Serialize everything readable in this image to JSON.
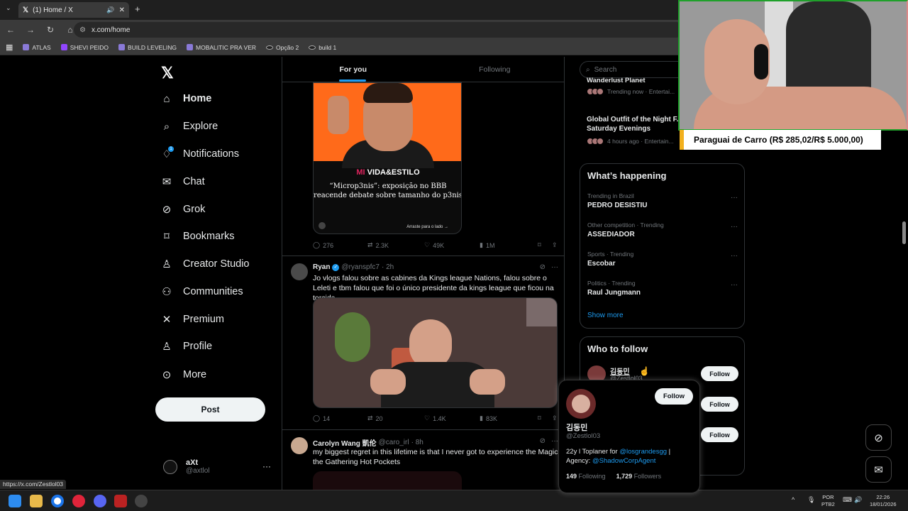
{
  "browser": {
    "tab_title": "(1) Home / X",
    "url": "x.com/home",
    "bookmarks": [
      "ATLAS",
      "SHEVI PEIDO",
      "BUILD LEVELING",
      "MOBALITIC PRA VER",
      "Opção 2",
      "build 1"
    ],
    "status_url": "https://x.com/Zestlol03"
  },
  "nav": {
    "items": [
      {
        "label": "Home",
        "icon": "home-icon"
      },
      {
        "label": "Explore",
        "icon": "search-icon"
      },
      {
        "label": "Notifications",
        "icon": "bell-icon",
        "badge": "1"
      },
      {
        "label": "Chat",
        "icon": "mail-icon"
      },
      {
        "label": "Grok",
        "icon": "grok-icon"
      },
      {
        "label": "Bookmarks",
        "icon": "bookmark-icon"
      },
      {
        "label": "Creator Studio",
        "icon": "creator-icon"
      },
      {
        "label": "Communities",
        "icon": "communities-icon"
      },
      {
        "label": "Premium",
        "icon": "x-icon"
      },
      {
        "label": "Profile",
        "icon": "profile-icon"
      },
      {
        "label": "More",
        "icon": "more-icon"
      }
    ],
    "post_label": "Post",
    "account": {
      "name": "aXt",
      "handle": "@axtlol"
    }
  },
  "feed": {
    "tabs": [
      "For you",
      "Following"
    ],
    "post1": {
      "brand_a": "MI",
      "brand_b": "VIDA&ESTILO",
      "headline": "“Microp3nis”: exposição no BBB reacende debate sobre tamanho do p3nis",
      "swipe": "Arraste para o lado",
      "replies": "276",
      "reposts": "2.3K",
      "likes": "49K",
      "views": "1M"
    },
    "post2": {
      "name": "Ryan",
      "handle": "@ryanspfc7",
      "time": "· 2h",
      "text": "Jo vlogs falou sobre as cabines da Kings league Nations, falou sobre o Leleti e tbm falou que foi o único presidente da kings league que ficou na torcida.",
      "replies": "14",
      "reposts": "20",
      "likes": "1.4K",
      "views": "83K"
    },
    "post3": {
      "name": "Carolyn Wang 凱伦",
      "handle": "@caro_irl",
      "time": "· 8h",
      "text": "my biggest regret in this lifetime is that I never got to experience the Magic the Gathering Hot Pockets"
    }
  },
  "right": {
    "search_placeholder": "Search",
    "top_trends": [
      {
        "title": "Wanderlust Planet",
        "meta": "Trending now · Entertai..."
      },
      {
        "title": "Global Outfit of the Night F... Saturday Evenings",
        "meta": "4 hours ago · Entertain..."
      }
    ],
    "happening_title": "What’s happening",
    "trends": [
      {
        "cat": "Trending in Brazil",
        "name": "PEDRO DESISTIU"
      },
      {
        "cat": "Other competition · Trending",
        "name": "ASSEDIADOR"
      },
      {
        "cat": "Sports · Trending",
        "name": "Escobar"
      },
      {
        "cat": "Politics · Trending",
        "name": "Raul Jungmann"
      }
    ],
    "show_more": "Show more",
    "wtf_title": "Who to follow",
    "wtf_first": {
      "name": "김동민",
      "handle": "@Zestlol03"
    },
    "follow_label": "Follow"
  },
  "hovercard": {
    "name": "김동민",
    "handle": "@Zestlol03",
    "bio_prefix": "22y l Toplaner for ",
    "bio_link1": "@losgrandesgg",
    "bio_mid": " | Agency: ",
    "bio_link2": "@ShadowCorpAgent",
    "following_count": "149",
    "following_label": "Following",
    "followers_count": "1,729",
    "followers_label": "Followers",
    "follow_label": "Follow"
  },
  "overlay": {
    "donation_text": "Paraguai de Carro (R$ 285,02/R$ 5.000,00)"
  },
  "taskbar": {
    "lang1": "POR",
    "lang2": "PTB2",
    "time": "22:26",
    "date": "18/01/2026"
  }
}
